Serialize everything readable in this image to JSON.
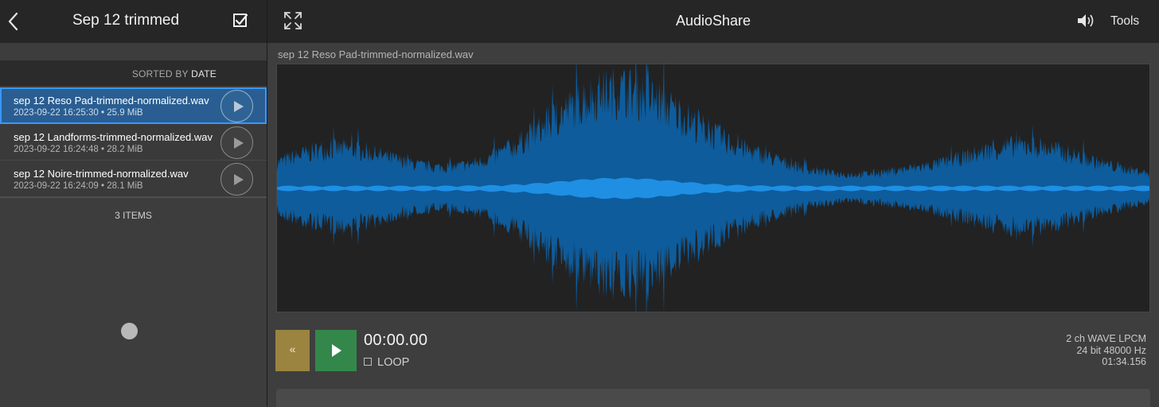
{
  "left_panel": {
    "title": "Sep 12 trimmed",
    "sort": {
      "prefix": "SORTED BY",
      "key": "DATE"
    },
    "files": [
      {
        "name": "sep 12 Reso Pad-trimmed-normalized.wav",
        "meta": "2023-09-22 16:25:30 • 25.9 MiB",
        "selected": true
      },
      {
        "name": "sep 12 Landforms-trimmed-normalized.wav",
        "meta": "2023-09-22 16:24:48 • 28.2 MiB",
        "selected": false
      },
      {
        "name": "sep 12 Noire-trimmed-normalized.wav",
        "meta": "2023-09-22 16:24:09 • 28.1 MiB",
        "selected": false
      }
    ],
    "items_count": "3 ITEMS",
    "icons": {
      "back": "chevron-left-icon",
      "select": "checkbox-icon",
      "row_play": "play-icon"
    }
  },
  "header": {
    "title": "AudioShare",
    "tools_label": "Tools",
    "icons": {
      "expand": "expand-icon",
      "volume": "speaker-icon"
    }
  },
  "player": {
    "current_file": "sep 12 Reso Pad-trimmed-normalized.wav",
    "time": "00:00.00",
    "loop_label": "LOOP",
    "loop_checked": false,
    "rewind_glyph": "«",
    "info": {
      "channels_format": "2 ch WAVE LPCM",
      "bit_rate": "24 bit 48000 Hz",
      "duration": "01:34.156"
    }
  },
  "colors": {
    "waveform": "#0e5c9c",
    "waveform_peak": "#1f8fe3",
    "selected_row": "#2a5e92",
    "selected_border": "#3a97ff",
    "rewind_button": "#9a8440",
    "play_button": "#34874a",
    "header_bg": "#262626"
  }
}
